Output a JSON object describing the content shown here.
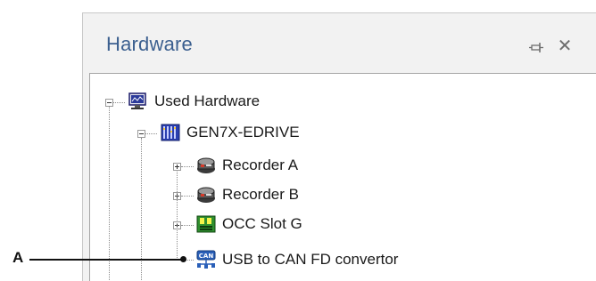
{
  "panel": {
    "title": "Hardware",
    "close_glyph": "✕"
  },
  "tree": {
    "root": {
      "label": "Used Hardware",
      "icon": "monitor-icon",
      "expanded": true
    },
    "device": {
      "label": "GEN7X-EDRIVE",
      "icon": "mainframe-icon",
      "expanded": true
    },
    "children": [
      {
        "label": "Recorder A",
        "icon": "recorder-icon",
        "expanded": false
      },
      {
        "label": "Recorder B",
        "icon": "recorder-icon",
        "expanded": false
      },
      {
        "label": "OCC Slot G",
        "icon": "occ-board-icon",
        "expanded": false
      },
      {
        "label": "USB to CAN FD convertor",
        "icon": "can-usb-icon",
        "expanded": null
      }
    ]
  },
  "callout": {
    "label": "A"
  },
  "colors": {
    "title": "#3b5f8f",
    "panel_bg": "#f2f2f2",
    "tree_bg": "#ffffff"
  }
}
